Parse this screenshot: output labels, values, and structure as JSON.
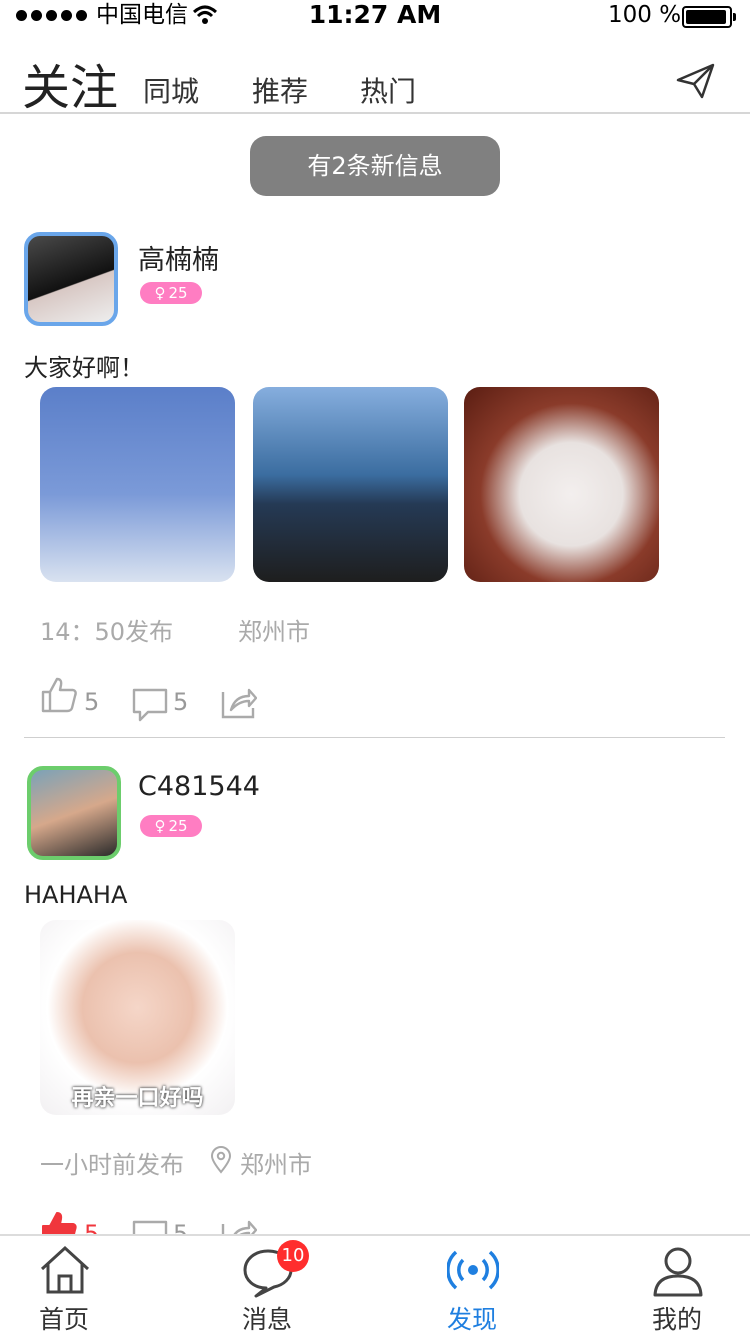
{
  "status_bar": {
    "carrier": "中国电信",
    "time": "11:27 AM",
    "battery_percent": "100 %"
  },
  "tabs": {
    "active": "关注",
    "items": [
      "同城",
      "推荐",
      "热门"
    ]
  },
  "new_info": "有2条新信息",
  "posts": [
    {
      "username": "高楠楠",
      "badge": "25",
      "content": "大家好啊！",
      "time": "14：50发布",
      "location": "郑州市",
      "likes": "5",
      "comments": "5",
      "liked": false
    },
    {
      "username": "C481544",
      "badge": "25",
      "content": "HAHAHA",
      "photo_caption": "再亲一口好吗",
      "time": "一小时前发布",
      "location": "郑州市",
      "likes": "5",
      "comments": "5",
      "liked": true
    }
  ],
  "nav": {
    "items": [
      {
        "label": "首页",
        "icon": "home-icon"
      },
      {
        "label": "消息",
        "icon": "message-icon",
        "badge": "10"
      },
      {
        "label": "发现",
        "icon": "broadcast-icon",
        "active": true
      },
      {
        "label": "我的",
        "icon": "user-icon"
      }
    ]
  },
  "colors": {
    "accent": "#1f7fe0",
    "badge_pink": "#ff7dc2",
    "like_red": "#f0363c",
    "unread_red": "#ff2d2d"
  }
}
